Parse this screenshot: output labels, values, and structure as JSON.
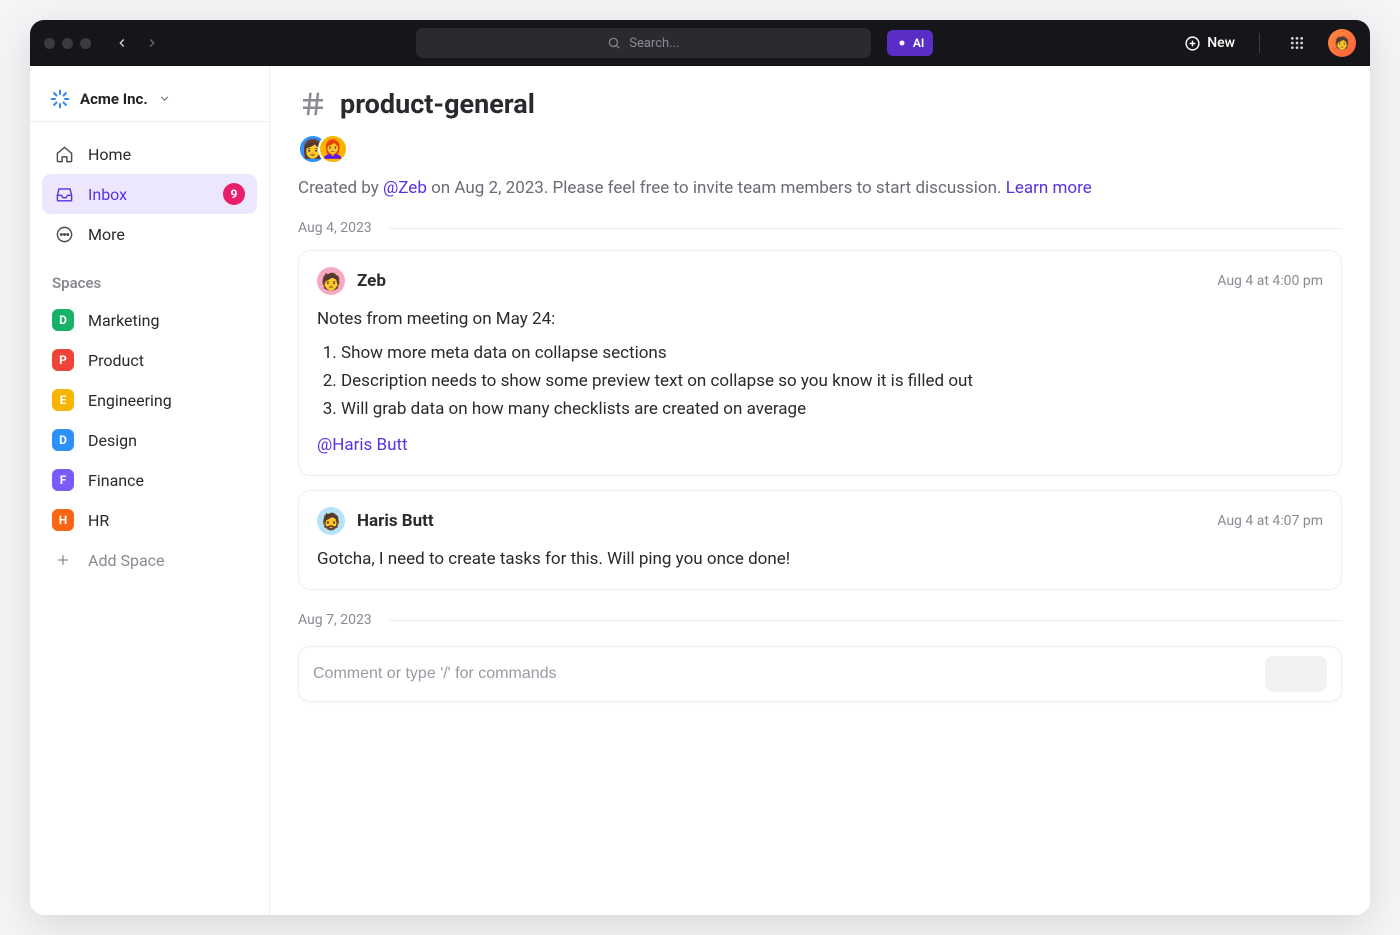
{
  "topbar": {
    "search_placeholder": "Search...",
    "ai_label": "AI",
    "new_label": "New"
  },
  "workspace": {
    "name": "Acme Inc."
  },
  "nav": {
    "home": "Home",
    "inbox": "Inbox",
    "inbox_badge": "9",
    "more": "More"
  },
  "spaces": {
    "title": "Spaces",
    "items": [
      {
        "initial": "D",
        "label": "Marketing",
        "color": "#17b26a"
      },
      {
        "initial": "P",
        "label": "Product",
        "color": "#f04438"
      },
      {
        "initial": "E",
        "label": "Engineering",
        "color": "#f7b500"
      },
      {
        "initial": "D",
        "label": "Design",
        "color": "#2e90fa"
      },
      {
        "initial": "F",
        "label": "Finance",
        "color": "#7a5af8"
      },
      {
        "initial": "H",
        "label": "HR",
        "color": "#fb6514"
      }
    ],
    "add_label": "Add Space"
  },
  "channel": {
    "name": "product-general",
    "member_avatars": [
      {
        "color": "#2e90fa",
        "emoji": "👩"
      },
      {
        "color": "#f7b500",
        "emoji": "👩‍🦰"
      }
    ],
    "desc_prefix": "Created by ",
    "desc_creator": "@Zeb",
    "desc_mid": " on Aug 2, 2023. Please feel free to invite team members to start discussion. ",
    "learn_more": "Learn more"
  },
  "thread": {
    "date1": "Aug 4, 2023",
    "messages": [
      {
        "author": "Zeb",
        "avatar_color": "#f9a8c2",
        "avatar_emoji": "🧑",
        "time": "Aug 4 at 4:00 pm",
        "intro": "Notes from meeting on May 24:",
        "items": [
          "Show more meta data on collapse sections",
          "Description needs to show some preview text on collapse so you know it is filled out",
          "Will grab data on how many checklists are created on average"
        ],
        "mention": "@Haris Butt"
      },
      {
        "author": "Haris Butt",
        "avatar_color": "#b5e3f7",
        "avatar_emoji": "🧔",
        "time": "Aug 4 at 4:07 pm",
        "text": "Gotcha, I need to create tasks for this. Will ping you once done!"
      }
    ],
    "date2": "Aug 7, 2023"
  },
  "composer": {
    "placeholder": "Comment or type '/' for commands"
  }
}
